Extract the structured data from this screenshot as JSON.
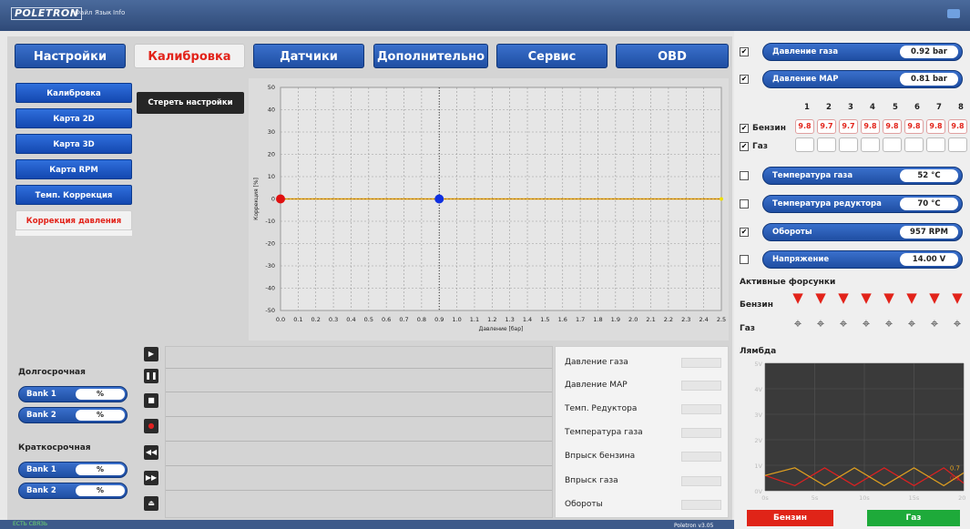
{
  "titlebar": {
    "logo": "POLETRON",
    "menu": [
      "Файл",
      "Язык",
      "Info"
    ]
  },
  "tabs": [
    {
      "label": "Настройки",
      "active": false
    },
    {
      "label": "Калибровка",
      "active": true
    },
    {
      "label": "Датчики",
      "active": false
    },
    {
      "label": "Дополнительно",
      "active": false
    },
    {
      "label": "Сервис",
      "active": false
    },
    {
      "label": "OBD",
      "active": false
    }
  ],
  "sidebar": {
    "items": [
      {
        "label": "Калибровка",
        "active": false
      },
      {
        "label": "Карта 2D",
        "active": false
      },
      {
        "label": "Карта 3D",
        "active": false
      },
      {
        "label": "Карта RPM",
        "active": false
      },
      {
        "label": "Темп. Коррекция",
        "active": false
      },
      {
        "label": "Коррекция давления",
        "active": true
      }
    ]
  },
  "clear_button": "Стереть настройки",
  "chart_data": {
    "type": "line",
    "xlabel": "Давление [бар]",
    "ylabel": "Коррекция [%]",
    "xlim": [
      0.0,
      2.5
    ],
    "ylim": [
      -50,
      50
    ],
    "x_ticks": [
      "0.0",
      "0.1",
      "0.2",
      "0.3",
      "0.4",
      "0.5",
      "0.6",
      "0.7",
      "0.8",
      "0.9",
      "1.0",
      "1.1",
      "1.2",
      "1.3",
      "1.4",
      "1.5",
      "1.6",
      "1.7",
      "1.8",
      "1.9",
      "2.0",
      "2.1",
      "2.2",
      "2.3",
      "2.4",
      "2.5"
    ],
    "y_ticks": [
      "50",
      "40",
      "30",
      "20",
      "10",
      "0",
      "-10",
      "-20",
      "-30",
      "-40",
      "-50"
    ],
    "series": [
      {
        "values": [
          [
            0.0,
            0
          ],
          [
            2.5,
            0
          ]
        ],
        "color": "#e0a000"
      }
    ],
    "points": [
      {
        "x": 0.0,
        "y": 0,
        "color": "#e01010"
      },
      {
        "x": 0.9,
        "y": 0,
        "color": "#1030e0"
      }
    ],
    "cursor_x": 0.9,
    "grid": true
  },
  "trims": {
    "long_title": "Долгосрочная",
    "short_title": "Краткосрочная",
    "long": [
      {
        "name": "Bank 1",
        "value": "%"
      },
      {
        "name": "Bank 2",
        "value": "%"
      }
    ],
    "short": [
      {
        "name": "Bank 1",
        "value": "%"
      },
      {
        "name": "Bank 2",
        "value": "%"
      }
    ]
  },
  "log_legend": [
    {
      "label": "Давление газа",
      "color": "#2a9a2a"
    },
    {
      "label": "Давление MAP",
      "color": "#9a8a3a"
    },
    {
      "label": "Темп. Редуктора",
      "color": "#e07020"
    },
    {
      "label": "Температура газа",
      "color": "#d040a0"
    },
    {
      "label": "Впрыск бензина",
      "color": "#e02020"
    },
    {
      "label": "Впрыск газа",
      "color": "#205020"
    },
    {
      "label": "Обороты",
      "color": "#666666"
    }
  ],
  "status": {
    "connection": "ЕСТЬ СВЯЗЬ",
    "version": "Poletron v3.05"
  },
  "right": {
    "gas_pressure": {
      "label": "Давление газа",
      "value": "0.92 bar",
      "checked": true
    },
    "map_pressure": {
      "label": "Давление MAP",
      "value": "0.81 bar",
      "checked": true
    },
    "columns": [
      "1",
      "2",
      "3",
      "4",
      "5",
      "6",
      "7",
      "8"
    ],
    "benzin_row": {
      "label": "Бензин",
      "checked": true,
      "values": [
        "9.8",
        "9.7",
        "9.7",
        "9.8",
        "9.8",
        "9.8",
        "9.8",
        "9.8"
      ]
    },
    "gas_row": {
      "label": "Газ",
      "checked": true
    },
    "gas_temp": {
      "label": "Температура газа",
      "value": "52 °C",
      "checked": false
    },
    "reducer_temp": {
      "label": "Температура редуктора",
      "value": "70 °C",
      "checked": false
    },
    "rpm": {
      "label": "Обороты",
      "value": "957 RPM",
      "checked": true
    },
    "voltage": {
      "label": "Напряжение",
      "value": "14.00 V",
      "checked": false
    },
    "injectors_title": "Активные форсунки",
    "inj_benzin": "Бензин",
    "inj_gas": "Газ",
    "lambda_title": "Лямбда",
    "lambda_chart": {
      "type": "line",
      "y_ticks": [
        "5V",
        "4V",
        "3V",
        "2V",
        "1V",
        "0V"
      ],
      "x_ticks": [
        "0s",
        "5s",
        "10s",
        "15s",
        "20s"
      ],
      "ylim": [
        0,
        5
      ],
      "xlim": [
        0,
        20
      ],
      "series": [
        {
          "color": "#e02020",
          "x": [
            0,
            3,
            6,
            9,
            12,
            15,
            18,
            20
          ],
          "y": [
            0.6,
            0.2,
            0.9,
            0.2,
            0.9,
            0.2,
            0.9,
            0.3
          ],
          "label": "0.3"
        },
        {
          "color": "#e0a020",
          "x": [
            0,
            3,
            6,
            9,
            12,
            15,
            18,
            20
          ],
          "y": [
            0.6,
            0.9,
            0.2,
            0.9,
            0.2,
            0.9,
            0.2,
            0.7
          ],
          "label": "0.7"
        }
      ]
    },
    "btn_benzin": "Бензин",
    "btn_gaz": "Газ"
  }
}
